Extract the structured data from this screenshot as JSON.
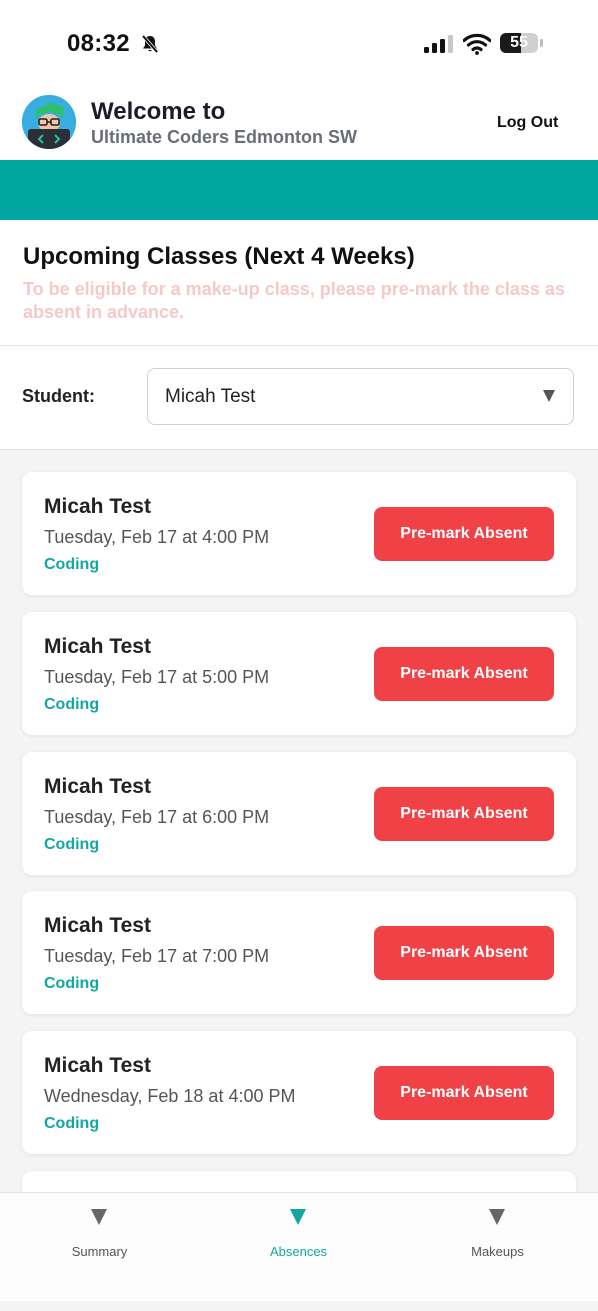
{
  "status_bar": {
    "time": "08:32",
    "battery_level": "55",
    "icons": [
      "bell-slash-icon",
      "cellular-signal-icon",
      "wifi-icon",
      "battery-icon"
    ]
  },
  "header": {
    "title": "Welcome to",
    "subtitle": "Ultimate Coders Edmonton SW",
    "logout_label": "Log Out",
    "accent_color": "#00a6a0"
  },
  "upcoming": {
    "title": "Upcoming Classes (Next 4 Weeks)",
    "notice": "To be eligible for a make-up class, please pre-mark the class as absent in advance."
  },
  "student_filter": {
    "label": "Student:",
    "selected": "Micah Test"
  },
  "classes": [
    {
      "student": "Micah Test",
      "when": "Tuesday, Feb 17 at 4:00 PM",
      "subject": "Coding",
      "action": "Pre-mark Absent"
    },
    {
      "student": "Micah Test",
      "when": "Tuesday, Feb 17 at 5:00 PM",
      "subject": "Coding",
      "action": "Pre-mark Absent"
    },
    {
      "student": "Micah Test",
      "when": "Tuesday, Feb 17 at 6:00 PM",
      "subject": "Coding",
      "action": "Pre-mark Absent"
    },
    {
      "student": "Micah Test",
      "when": "Tuesday, Feb 17 at 7:00 PM",
      "subject": "Coding",
      "action": "Pre-mark Absent"
    },
    {
      "student": "Micah Test",
      "when": "Wednesday, Feb 18 at 4:00 PM",
      "subject": "Coding",
      "action": "Pre-mark Absent"
    }
  ],
  "tabs": [
    {
      "label": "Summary",
      "icon": "triangle-down-icon",
      "active": false
    },
    {
      "label": "Absences",
      "icon": "triangle-down-icon",
      "active": true
    },
    {
      "label": "Makeups",
      "icon": "triangle-down-icon",
      "active": false
    }
  ],
  "colors": {
    "teal": "#00a6a0",
    "button_red": "#ef4146",
    "notice_pink": "#f6c9c9"
  }
}
